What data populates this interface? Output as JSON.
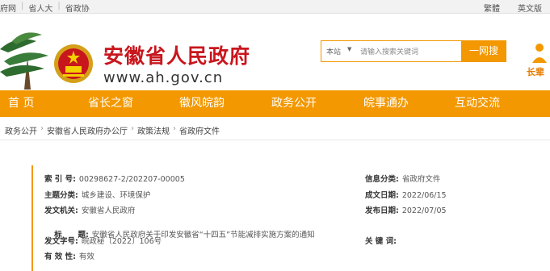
{
  "topbar": {
    "links": [
      "府网",
      "省人大",
      "省政协"
    ],
    "right": [
      "繁體",
      "英文版"
    ]
  },
  "header": {
    "title": "安徽省人民政府",
    "url": "www.ah.gov.cn",
    "search": {
      "scope": "本站",
      "placeholder": "请输入搜索关键词",
      "button": "一网搜"
    },
    "elder_label": "长辈"
  },
  "nav": {
    "items": [
      "首 页",
      "省长之窗",
      "徽风皖韵",
      "政务公开",
      "皖事通办",
      "互动交流"
    ]
  },
  "breadcrumb": [
    "政务公开",
    "安徽省人民政府办公厅",
    "政策法规",
    "省政府文件"
  ],
  "meta": {
    "index_label": "索 引 号:",
    "index_value": "00298627-2/202207-00005",
    "category_label": "信息分类:",
    "category_value": "省政府文件",
    "theme_label": "主题分类:",
    "theme_value": "城乡建设、环境保护",
    "date_label": "成文日期:",
    "date_value": "2022/06/15",
    "org_label": "发文机关:",
    "org_value": "安徽省人民政府",
    "pub_label": "发布日期:",
    "pub_value": "2022/07/05",
    "title_label": "标      题:",
    "title_value": "安徽省人民政府关于印发安徽省“十四五”节能减排实施方案的通知",
    "docno_label": "发文字号:",
    "docno_value": "皖政秘〔2022〕106号",
    "keywords_label": "关 键 词:",
    "keywords_value": "",
    "valid_label": "有 效 性:",
    "valid_value": "有效"
  },
  "colors": {
    "accent": "#f39800",
    "brand_red": "#c8161d"
  }
}
